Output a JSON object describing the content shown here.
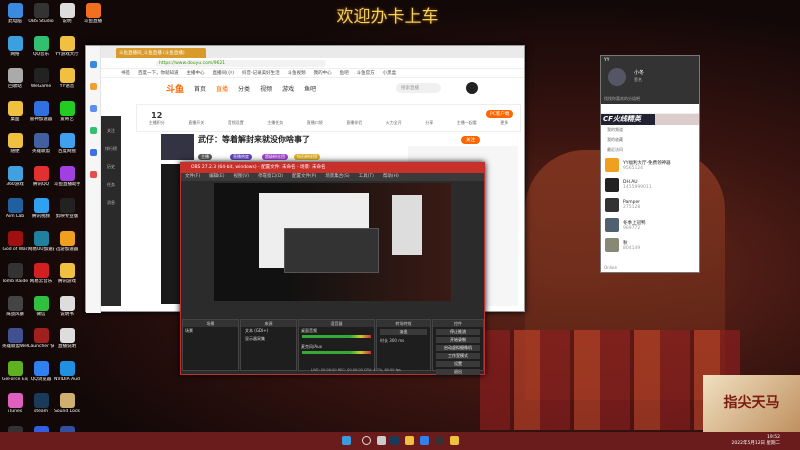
{
  "banner": "欢迎办卡上车",
  "desktop_icons": [
    [
      "此电脑",
      "#3a8be0"
    ],
    [
      "OBS Studio",
      "#333"
    ],
    [
      "说明",
      "#ddd"
    ],
    [
      "斗鱼直播",
      "#f07020"
    ],
    [
      "网络",
      "#3aa0e0"
    ],
    [
      "QQ音乐",
      "#30c070"
    ],
    [
      "YY游戏大厅",
      "#f0c040"
    ],
    [
      "",
      ""
    ],
    [
      "回收站",
      "#aaa"
    ],
    [
      "WeGame",
      "#222"
    ],
    [
      "YY语音",
      "#f0c040"
    ],
    [
      "",
      ""
    ],
    [
      "桌面",
      "#f0c040"
    ],
    [
      "雷神加速器",
      "#3070e0"
    ],
    [
      "爱奇艺",
      "#2c2"
    ],
    [
      "",
      ""
    ],
    [
      "随便",
      "#f0c040"
    ],
    [
      "英雄联盟",
      "#4060a0"
    ],
    [
      "百度网盘",
      "#40a0f0"
    ],
    [
      "",
      ""
    ],
    [
      "360游戏",
      "#40a0e0"
    ],
    [
      "腾讯QQ",
      "#e03030"
    ],
    [
      "斗鱼直播助手",
      "#a040e0"
    ],
    [
      "",
      ""
    ],
    [
      "Aim Lab",
      "#2060a0"
    ],
    [
      "腾讯视频",
      "#30a0f0"
    ],
    [
      "剪映专业版",
      "#222"
    ],
    [
      "",
      ""
    ],
    [
      "God of War",
      "#a01010"
    ],
    [
      "网易UU加速器",
      "#2080a0"
    ],
    [
      "迅游加速器",
      "#f0a020"
    ],
    [
      "",
      ""
    ],
    [
      "Tomb Raider",
      "#333"
    ],
    [
      "网易云音乐",
      "#d02020"
    ],
    [
      "腾讯游戏",
      "#f0c040"
    ],
    [
      "",
      ""
    ],
    [
      "海战风暴",
      "#444"
    ],
    [
      "微信",
      "#30c040"
    ],
    [
      "说明书",
      "#ddd"
    ],
    [
      "",
      ""
    ],
    [
      "英雄联盟WeGame",
      "#405090"
    ],
    [
      "Launcher 快捷方式",
      "#a02020"
    ],
    [
      "直播说明",
      "#ddd"
    ],
    [
      "",
      ""
    ],
    [
      "GeForce Experience",
      "#60b020"
    ],
    [
      "QQ浏览器",
      "#3080f0"
    ],
    [
      "NVIDIA Audio",
      "#2090e0"
    ],
    [
      "",
      ""
    ],
    [
      "iTunes",
      "#e060c0"
    ],
    [
      "steam",
      "#1a3a5a"
    ],
    [
      "Sound Lock",
      "#d0b070"
    ],
    [
      "",
      ""
    ],
    [
      "Logitech G HUB",
      "#333"
    ],
    [
      "WPS 2019",
      "#3060e0"
    ],
    [
      "英雄联盟",
      "#3050a0"
    ],
    [
      "",
      ""
    ]
  ],
  "browser": {
    "tab_title": "斗鱼直播间_斗鱼直播 (斗鱼直播)",
    "url": "https://www.douyu.com/9621",
    "bookmarks": [
      "书签",
      "百度一下，你就知道",
      "主播中心",
      "直播间(小)",
      "抖音-记录美好生活",
      "斗鱼视频",
      "我的中心",
      "鱼吧",
      "斗鱼官方",
      "小黑盒"
    ],
    "left_side_labels": [
      "关注",
      "排行榜",
      "历史",
      "任务",
      "消息"
    ],
    "nav": [
      "首页",
      "直播",
      "分类",
      "视频",
      "游戏",
      "鱼吧"
    ],
    "logo": "斗鱼",
    "search_placeholder": "搜索直播",
    "toolbar": [
      {
        "v": "12",
        "l": "主播积分"
      },
      {
        "v": "",
        "l": "直播开关"
      },
      {
        "v": "",
        "l": "音频设置"
      },
      {
        "v": "",
        "l": "主播任务"
      },
      {
        "v": "",
        "l": "直播口袋"
      },
      {
        "v": "",
        "l": "直播伴侣"
      },
      {
        "v": "",
        "l": "火力全开"
      },
      {
        "v": "",
        "l": "分享"
      },
      {
        "v": "",
        "l": "主播一起看"
      },
      {
        "v": "",
        "l": "更多"
      }
    ],
    "pc_button": "PC客户端",
    "room_title": "武仔：等着解封来就没你啥事了",
    "follow": "关注",
    "pills": [
      "主播",
      "直播热度",
      "超级粉丝团",
      "钻石粉丝团"
    ]
  },
  "obs": {
    "title": "OBS 27.2.3 (64-bit, windows) - 配置文件: 未命名 - 场景: 未命名",
    "menu": [
      "文件(F)",
      "编辑(E)",
      "视图(V)",
      "停靠窗口(D)",
      "配置文件(P)",
      "场景集合(S)",
      "工具(T)",
      "帮助(H)"
    ],
    "panels": [
      "场景",
      "来源",
      "混音器",
      "转场特效",
      "控件"
    ],
    "scene": "场景",
    "sources": [
      "文本 (GDI+)",
      "显示器采集"
    ],
    "mixer": [
      "桌面音频",
      "麦克风/Aux"
    ],
    "transition": "淡出",
    "duration_label": "时长",
    "duration": "300 ms",
    "controls": [
      "停止推流",
      "开始录制",
      "启动虚拟摄像机",
      "工作室模式",
      "设置",
      "退出"
    ],
    "status": "LIVE: 00:00:00   REC: 00:00:00   CPU: 4.7%, 60.00 fps"
  },
  "chat": {
    "title": "YY",
    "name": "小冬",
    "sub": "签名",
    "search_placeholder": "找找你喜欢的分组吧",
    "banner": "CF火线精英",
    "sections": [
      "我的频道",
      "我的收藏",
      "最近访问"
    ],
    "items": [
      {
        "name": "YY福利大厅-免费领神器",
        "id": "9565124",
        "c": "#f0a020"
      },
      {
        "name": "DH.AU",
        "id": "1455999011",
        "c": "#222"
      },
      {
        "name": "Pamper",
        "id": "275128",
        "c": "#333"
      },
      {
        "name": "冬季上冠鸭",
        "id": "969772",
        "c": "#506070"
      },
      {
        "name": "秋",
        "id": "804149",
        "c": "#887"
      }
    ],
    "bottom": "Online"
  },
  "ad": "指尖天马",
  "clock": {
    "time": "19:52",
    "date": "2022年5月12日 星期二"
  }
}
